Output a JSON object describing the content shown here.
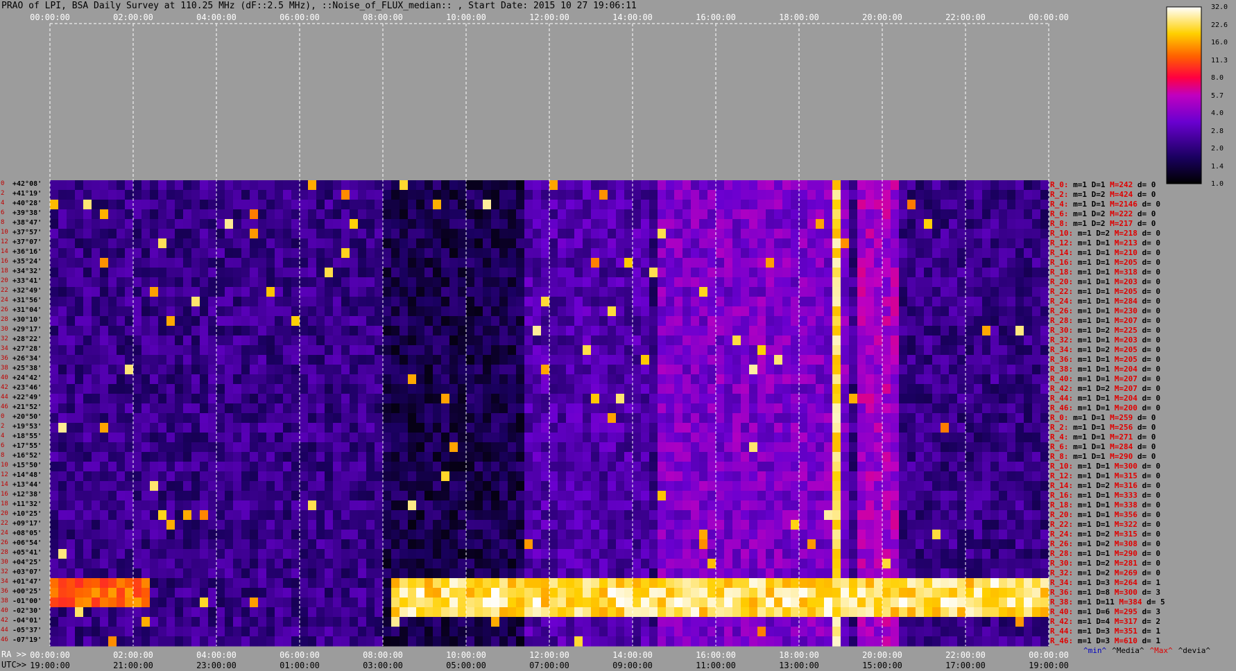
{
  "title": "PRAO of LPI, BSA Daily Survey at 110.25 MHz (dF::2.5 MHz), ::Noise_of_FLUX_median:: , Start Date: 2015 10 27 19:06:11",
  "ra_axis_label": "RA >>",
  "utc_axis_label": "UTC>>",
  "colors": {
    "background": "#9c9c9c",
    "row_label": "#c00000",
    "max_label": "#e00000"
  },
  "chart_data": {
    "type": "heatmap",
    "top_time_ticks": [
      "00:00:00",
      "02:00:00",
      "04:00:00",
      "06:00:00",
      "08:00:00",
      "10:00:00",
      "12:00:00",
      "14:00:00",
      "16:00:00",
      "18:00:00",
      "20:00:00",
      "22:00:00",
      "00:00:00"
    ],
    "ra_ticks": [
      "00:00:00",
      "02:00:00",
      "04:00:00",
      "06:00:00",
      "08:00:00",
      "10:00:00",
      "12:00:00",
      "14:00:00",
      "16:00:00",
      "18:00:00",
      "20:00:00",
      "22:00:00",
      "00:00:00"
    ],
    "utc_ticks": [
      "19:00:00",
      "21:00:00",
      "23:00:00",
      "01:00:00",
      "03:00:00",
      "05:00:00",
      "07:00:00",
      "09:00:00",
      "11:00:00",
      "13:00:00",
      "15:00:00",
      "17:00:00",
      "19:00:00"
    ],
    "colorbar": {
      "ticks": [
        "32.0",
        "22.6",
        "16.0",
        "11.3",
        "8.0",
        "5.7",
        "4.0",
        "2.8",
        "2.0",
        "1.4",
        "1.0"
      ],
      "min": 1.0,
      "max": 32.0,
      "scale": "log"
    },
    "rows": [
      {
        "idx": "0",
        "dec": "+42°08'",
        "r": "R_0:",
        "m": "m=1",
        "d": "D=1",
        "M": "M=242",
        "dd": "d= 0"
      },
      {
        "idx": "2",
        "dec": "+41°19'",
        "r": "R_2:",
        "m": "m=1",
        "d": "D=2",
        "M": "M=424",
        "dd": "d= 0"
      },
      {
        "idx": "4",
        "dec": "+40°28'",
        "r": "R_4:",
        "m": "m=1",
        "d": "D=1",
        "M": "M=2146",
        "dd": "d= 0"
      },
      {
        "idx": "6",
        "dec": "+39°38'",
        "r": "R_6:",
        "m": "m=1",
        "d": "D=2",
        "M": "M=222",
        "dd": "d= 0"
      },
      {
        "idx": "8",
        "dec": "+38°47'",
        "r": "R_8:",
        "m": "m=1",
        "d": "D=2",
        "M": "M=217",
        "dd": "d= 0"
      },
      {
        "idx": "10",
        "dec": "+37°57'",
        "r": "R_10:",
        "m": "m=1",
        "d": "D=2",
        "M": "M=218",
        "dd": "d= 0"
      },
      {
        "idx": "12",
        "dec": "+37°07'",
        "r": "R_12:",
        "m": "m=1",
        "d": "D=1",
        "M": "M=213",
        "dd": "d= 0"
      },
      {
        "idx": "14",
        "dec": "+36°16'",
        "r": "R_14:",
        "m": "m=1",
        "d": "D=1",
        "M": "M=210",
        "dd": "d= 0"
      },
      {
        "idx": "16",
        "dec": "+35°24'",
        "r": "R_16:",
        "m": "m=1",
        "d": "D=1",
        "M": "M=205",
        "dd": "d= 0"
      },
      {
        "idx": "18",
        "dec": "+34°32'",
        "r": "R_18:",
        "m": "m=1",
        "d": "D=1",
        "M": "M=318",
        "dd": "d= 0"
      },
      {
        "idx": "20",
        "dec": "+33°41'",
        "r": "R_20:",
        "m": "m=1",
        "d": "D=1",
        "M": "M=203",
        "dd": "d= 0"
      },
      {
        "idx": "22",
        "dec": "+32°49'",
        "r": "R_22:",
        "m": "m=1",
        "d": "D=1",
        "M": "M=205",
        "dd": "d= 0"
      },
      {
        "idx": "24",
        "dec": "+31°56'",
        "r": "R_24:",
        "m": "m=1",
        "d": "D=1",
        "M": "M=284",
        "dd": "d= 0"
      },
      {
        "idx": "26",
        "dec": "+31°04'",
        "r": "R_26:",
        "m": "m=1",
        "d": "D=1",
        "M": "M=230",
        "dd": "d= 0"
      },
      {
        "idx": "28",
        "dec": "+30°10'",
        "r": "R_28:",
        "m": "m=1",
        "d": "D=1",
        "M": "M=207",
        "dd": "d= 0"
      },
      {
        "idx": "30",
        "dec": "+29°17'",
        "r": "R_30:",
        "m": "m=1",
        "d": "D=2",
        "M": "M=225",
        "dd": "d= 0"
      },
      {
        "idx": "32",
        "dec": "+28°22'",
        "r": "R_32:",
        "m": "m=1",
        "d": "D=1",
        "M": "M=203",
        "dd": "d= 0"
      },
      {
        "idx": "34",
        "dec": "+27°28'",
        "r": "R_34:",
        "m": "m=1",
        "d": "D=2",
        "M": "M=205",
        "dd": "d= 0"
      },
      {
        "idx": "36",
        "dec": "+26°34'",
        "r": "R_36:",
        "m": "m=1",
        "d": "D=1",
        "M": "M=205",
        "dd": "d= 0"
      },
      {
        "idx": "38",
        "dec": "+25°38'",
        "r": "R_38:",
        "m": "m=1",
        "d": "D=1",
        "M": "M=204",
        "dd": "d= 0"
      },
      {
        "idx": "40",
        "dec": "+24°42'",
        "r": "R_40:",
        "m": "m=1",
        "d": "D=1",
        "M": "M=207",
        "dd": "d= 0"
      },
      {
        "idx": "42",
        "dec": "+23°46'",
        "r": "R_42:",
        "m": "m=1",
        "d": "D=2",
        "M": "M=207",
        "dd": "d= 0"
      },
      {
        "idx": "44",
        "dec": "+22°49'",
        "r": "R_44:",
        "m": "m=1",
        "d": "D=1",
        "M": "M=204",
        "dd": "d= 0"
      },
      {
        "idx": "46",
        "dec": "+21°52'",
        "r": "R_46:",
        "m": "m=1",
        "d": "D=1",
        "M": "M=200",
        "dd": "d= 0"
      },
      {
        "idx": "0",
        "dec": "+20°50'",
        "r": "R_0:",
        "m": "m=1",
        "d": "D=1",
        "M": "M=259",
        "dd": "d= 0"
      },
      {
        "idx": "2",
        "dec": "+19°53'",
        "r": "R_2:",
        "m": "m=1",
        "d": "D=1",
        "M": "M=256",
        "dd": "d= 0"
      },
      {
        "idx": "4",
        "dec": "+18°55'",
        "r": "R_4:",
        "m": "m=1",
        "d": "D=1",
        "M": "M=271",
        "dd": "d= 0"
      },
      {
        "idx": "6",
        "dec": "+17°55'",
        "r": "R_6:",
        "m": "m=1",
        "d": "D=1",
        "M": "M=284",
        "dd": "d= 0"
      },
      {
        "idx": "8",
        "dec": "+16°52'",
        "r": "R_8:",
        "m": "m=1",
        "d": "D=1",
        "M": "M=290",
        "dd": "d= 0"
      },
      {
        "idx": "10",
        "dec": "+15°50'",
        "r": "R_10:",
        "m": "m=1",
        "d": "D=1",
        "M": "M=300",
        "dd": "d= 0"
      },
      {
        "idx": "12",
        "dec": "+14°48'",
        "r": "R_12:",
        "m": "m=1",
        "d": "D=1",
        "M": "M=315",
        "dd": "d= 0"
      },
      {
        "idx": "14",
        "dec": "+13°44'",
        "r": "R_14:",
        "m": "m=1",
        "d": "D=2",
        "M": "M=316",
        "dd": "d= 0"
      },
      {
        "idx": "16",
        "dec": "+12°38'",
        "r": "R_16:",
        "m": "m=1",
        "d": "D=1",
        "M": "M=333",
        "dd": "d= 0"
      },
      {
        "idx": "18",
        "dec": "+11°32'",
        "r": "R_18:",
        "m": "m=1",
        "d": "D=1",
        "M": "M=338",
        "dd": "d= 0"
      },
      {
        "idx": "20",
        "dec": "+10°25'",
        "r": "R_20:",
        "m": "m=1",
        "d": "D=1",
        "M": "M=356",
        "dd": "d= 0"
      },
      {
        "idx": "22",
        "dec": "+09°17'",
        "r": "R_22:",
        "m": "m=1",
        "d": "D=1",
        "M": "M=322",
        "dd": "d= 0"
      },
      {
        "idx": "24",
        "dec": "+08°05'",
        "r": "R_24:",
        "m": "m=1",
        "d": "D=2",
        "M": "M=315",
        "dd": "d= 0"
      },
      {
        "idx": "26",
        "dec": "+06°54'",
        "r": "R_26:",
        "m": "m=1",
        "d": "D=2",
        "M": "M=308",
        "dd": "d= 0"
      },
      {
        "idx": "28",
        "dec": "+05°41'",
        "r": "R_28:",
        "m": "m=1",
        "d": "D=1",
        "M": "M=290",
        "dd": "d= 0"
      },
      {
        "idx": "30",
        "dec": "+04°25'",
        "r": "R_30:",
        "m": "m=1",
        "d": "D=2",
        "M": "M=281",
        "dd": "d= 0"
      },
      {
        "idx": "32",
        "dec": "+03°07'",
        "r": "R_32:",
        "m": "m=1",
        "d": "D=2",
        "M": "M=269",
        "dd": "d= 0"
      },
      {
        "idx": "34",
        "dec": "+01°47'",
        "r": "R_34:",
        "m": "m=1",
        "d": "D=3",
        "M": "M=264",
        "dd": "d= 1"
      },
      {
        "idx": "36",
        "dec": "+00°25'",
        "r": "R_36:",
        "m": "m=1",
        "d": "D=8",
        "M": "M=300",
        "dd": "d= 3"
      },
      {
        "idx": "38",
        "dec": "-01°00'",
        "r": "R_38:",
        "m": "m=1",
        "d": "D=11",
        "M": "M=384",
        "dd": "d= 5"
      },
      {
        "idx": "40",
        "dec": "-02°30'",
        "r": "R_40:",
        "m": "m=1",
        "d": "D=6",
        "M": "M=295",
        "dd": "d= 3"
      },
      {
        "idx": "42",
        "dec": "-04°01'",
        "r": "R_42:",
        "m": "m=1",
        "d": "D=4",
        "M": "M=317",
        "dd": "d= 2"
      },
      {
        "idx": "44",
        "dec": "-05°37'",
        "r": "R_44:",
        "m": "m=1",
        "d": "D=3",
        "M": "M=351",
        "dd": "d= 1"
      },
      {
        "idx": "46",
        "dec": "-07°19'",
        "r": "R_46:",
        "m": "m=1",
        "d": "D=3",
        "M": "M=610",
        "dd": "d= 1"
      }
    ],
    "legend": [
      {
        "label": "^min^",
        "color": "#0000c0"
      },
      {
        "label": "^Media^",
        "color": "#000000"
      },
      {
        "label": "^Max^",
        "color": "#e00000"
      },
      {
        "label": "^devia^",
        "color": "#000000"
      }
    ]
  }
}
